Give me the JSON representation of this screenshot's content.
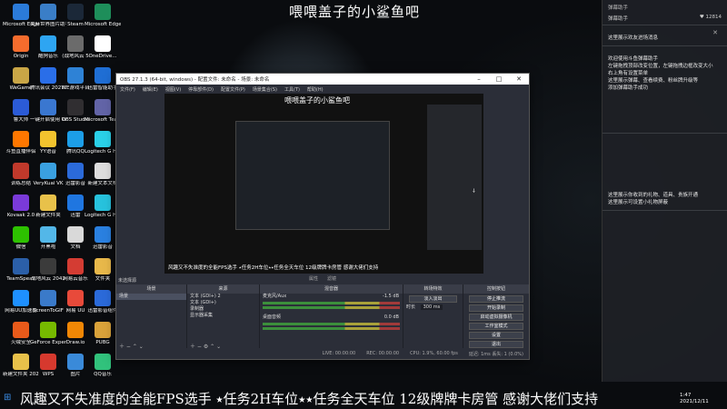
{
  "desktop_icons": [
    {
      "label": "Microsoft Edge",
      "color": "#2b7bd9"
    },
    {
      "label": "夹麻世界图片助手",
      "color": "#3a7ec7"
    },
    {
      "label": "Steam",
      "color": "#1b2838"
    },
    {
      "label": "Microsoft Edge",
      "color": "#1e8e5a"
    },
    {
      "label": "Origin",
      "color": "#f56c2d"
    },
    {
      "label": "酷狗音乐",
      "color": "#2ea5f2"
    },
    {
      "label": "(战地风云 5",
      "color": "#6b6b6b"
    },
    {
      "label": "OneDrive...",
      "color": "#ffffff"
    },
    {
      "label": "WeGame",
      "color": "#c9a646"
    },
    {
      "label": "腾讯会议 2021061...",
      "color": "#2a6ee8"
    },
    {
      "label": "WE游戏平台",
      "color": "#2e82d6"
    },
    {
      "label": "迅雷智能助手",
      "color": "#1f6ed4"
    },
    {
      "label": "鲁大师",
      "color": "#2b5bd7"
    },
    {
      "label": "一键开启使用 Windows...",
      "color": "#3a77d0"
    },
    {
      "label": "OBS Studio",
      "color": "#302e31"
    },
    {
      "label": "Microsoft Teams",
      "color": "#6264a7"
    },
    {
      "label": "斗鱼直播伴侣",
      "color": "#ff7700"
    },
    {
      "label": "YY语音",
      "color": "#f2c32e"
    },
    {
      "label": "腾讯QQ",
      "color": "#1c9ee8"
    },
    {
      "label": "Logitech G HUB",
      "color": "#2ad0e8"
    },
    {
      "label": "训练总结",
      "color": "#c0392b"
    },
    {
      "label": "VeryKuai VK",
      "color": "#3aa0e0"
    },
    {
      "label": "迅雷影音",
      "color": "#2b6ad9"
    },
    {
      "label": "新建文本文档",
      "color": "#dddddd"
    },
    {
      "label": "Kovaak 2.0",
      "color": "#7a3ad9"
    },
    {
      "label": "新建文件夹",
      "color": "#e8c14a"
    },
    {
      "label": "迅雷",
      "color": "#1f76e0"
    },
    {
      "label": "Logitech G HUB",
      "color": "#27c2dd"
    },
    {
      "label": "微信",
      "color": "#2dc100"
    },
    {
      "label": "开黑啦",
      "color": "#53b7e8"
    },
    {
      "label": "文档",
      "color": "#d9d9d9"
    },
    {
      "label": "迅雷影音",
      "color": "#2a80e0"
    },
    {
      "label": "TeamSpeak",
      "color": "#2b5fa8"
    },
    {
      "label": "战地风云 2042",
      "color": "#3b3b3b"
    },
    {
      "label": "网易云音乐",
      "color": "#d43c33"
    },
    {
      "label": "文件夹",
      "color": "#e8b84a"
    },
    {
      "label": "网易UU加速器",
      "color": "#1e90ff"
    },
    {
      "label": "ScreenToGIF",
      "color": "#3a7ac9"
    },
    {
      "label": "网易 UU",
      "color": "#e84a3a"
    },
    {
      "label": "迅雷影音组件",
      "color": "#2b6ad9"
    },
    {
      "label": "火绒安全",
      "color": "#e85a1a"
    },
    {
      "label": "GeForce Experience",
      "color": "#76b900"
    },
    {
      "label": "Draw.io",
      "color": "#f08705"
    },
    {
      "label": "PUBG",
      "color": "#d9a23a"
    },
    {
      "label": "新建文件夹 2021090...",
      "color": "#e8c14a"
    },
    {
      "label": "WPS",
      "color": "#d6392e"
    },
    {
      "label": "图片",
      "color": "#3a8ad9"
    },
    {
      "label": "QQ音乐",
      "color": "#31c27c"
    }
  ],
  "stream_title": "喂喂盖子的小鲨鱼吧",
  "chat_panel": {
    "header": "弹幕助手",
    "tabs": [
      "弹幕助手",
      "♥ 12814"
    ],
    "panel1_title": "这里展示欢友进场消息",
    "panel1_lines": [
      "欢迎使用斗鱼弹幕助手",
      "左键拖拽顶部改变位置，左键拖拽边框改变大小",
      "右上角有设置菜单",
      "这里展示弹幕、查看续费、粉丝牌升级等",
      "添加弹幕助手成功"
    ],
    "panel2_lines": [
      "这里展示你收到的礼物、道具、贵族开通",
      "这里展示可设置小礼物屏蔽"
    ]
  },
  "obs": {
    "title": "OBS 27.1.3 (64-bit, windows) - 配置文件: 未命名 - 场景: 未命名",
    "menu": [
      "文件(F)",
      "编辑(E)",
      "视图(V)",
      "停靠部件(D)",
      "配置文件(P)",
      "场景集合(S)",
      "工具(T)",
      "帮助(H)"
    ],
    "preview_title": "喂喂盖子的小鲨鱼吧",
    "preview_ticker": "风趣又不失准度的全能FPS选手 ⭑任务2H车位⭑⭑任务全天车位 12级牌牌卡房管 感谢大佬们支持",
    "scene_label": "未选择源",
    "toolbar_items": [
      "属性",
      "滤镜"
    ],
    "docks": {
      "scenes": {
        "header": "场景",
        "items": [
          "场景"
        ]
      },
      "sources": {
        "header": "来源",
        "items": [
          "文本 (GDI+) 2",
          "文本 (GDI+)",
          "录制器",
          "显示器采集"
        ]
      },
      "mixer": {
        "header": "混音器",
        "channels": [
          {
            "name": "麦克风/Aux",
            "level": "-1.5 dB"
          },
          {
            "name": "桌面音频",
            "level": "0.0 dB"
          }
        ]
      },
      "transitions": {
        "header": "转场特效",
        "type": "淡入淡出",
        "duration_label": "时长",
        "duration": "300 ms"
      },
      "controls": {
        "header": "控制按钮",
        "buttons": [
          "停止推流",
          "开始录制",
          "启动虚拟摄像机",
          "工作室模式",
          "设置",
          "退出"
        ]
      }
    },
    "statusbar": [
      "LIVE: 00:00:00",
      "REC: 00:00:00",
      "CPU: 1.9%, 60.00 fps",
      "延迟: 1ms 丢失: 1 (0.0%)"
    ]
  },
  "bottom_ticker": "风趣又不失准度的全能FPS选手 ⭑任务2H车位⭑⭑任务全天车位 12级牌牌卡房管 感谢大佬们支持",
  "clock": {
    "time": "1:47",
    "date": "2021/12/11"
  }
}
